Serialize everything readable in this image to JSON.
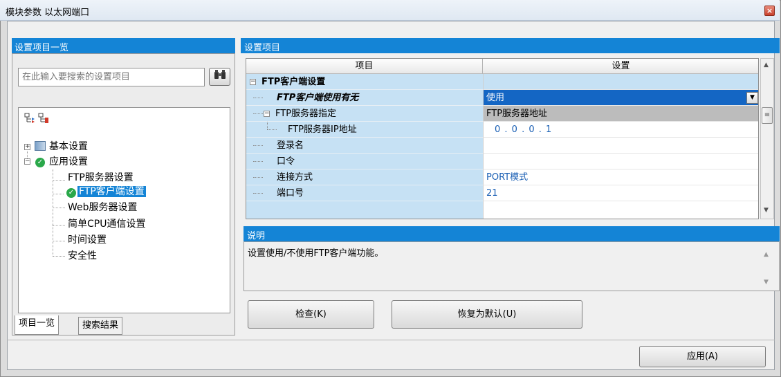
{
  "window": {
    "title": "模块参数 以太网端口",
    "close_glyph": "×"
  },
  "left_panel": {
    "header": "设置项目一览",
    "search_placeholder": "在此输入要搜索的设置项目",
    "search_icon": "binoculars-icon",
    "toolbar_icons": [
      "expand-all-icon",
      "collapse-all-icon"
    ],
    "tree": [
      {
        "label": "基本设置",
        "level": 0,
        "expanded": false
      },
      {
        "label": "应用设置",
        "level": 0,
        "expanded": true,
        "checked": true
      },
      {
        "label": "FTP服务器设置",
        "level": 1
      },
      {
        "label": "FTP客户端设置",
        "level": 1,
        "selected": true,
        "checked": true
      },
      {
        "label": "Web服务器设置",
        "level": 1
      },
      {
        "label": "简单CPU通信设置",
        "level": 1
      },
      {
        "label": "时间设置",
        "level": 1
      },
      {
        "label": "安全性",
        "level": 1
      }
    ],
    "tabs": [
      "项目一览",
      "搜索结果"
    ]
  },
  "right_panel": {
    "header": "设置项目",
    "columns": [
      "项目",
      "设置"
    ],
    "rows": [
      {
        "label": "FTP客户端设置",
        "value": ""
      },
      {
        "label": "FTP客户端使用有无",
        "value": "使用"
      },
      {
        "label": "FTP服务器指定",
        "value": "FTP服务器地址"
      },
      {
        "label": "FTP服务器IP地址",
        "value": "0 . 0 . 0 . 1"
      },
      {
        "label": "登录名",
        "value": ""
      },
      {
        "label": "口令",
        "value": ""
      },
      {
        "label": "连接方式",
        "value": "PORT模式"
      },
      {
        "label": "端口号",
        "value": "21"
      }
    ],
    "description_header": "说明",
    "description_text": "设置使用/不使用FTP客户端功能。",
    "buttons": {
      "check": "检查(K)",
      "restore": "恢复为默认(U)"
    }
  },
  "footer": {
    "apply": "应用(A)"
  },
  "colors": {
    "accent": "#1484d6",
    "selection": "#1466c4",
    "row_label_bg": "#c6e1f4"
  }
}
